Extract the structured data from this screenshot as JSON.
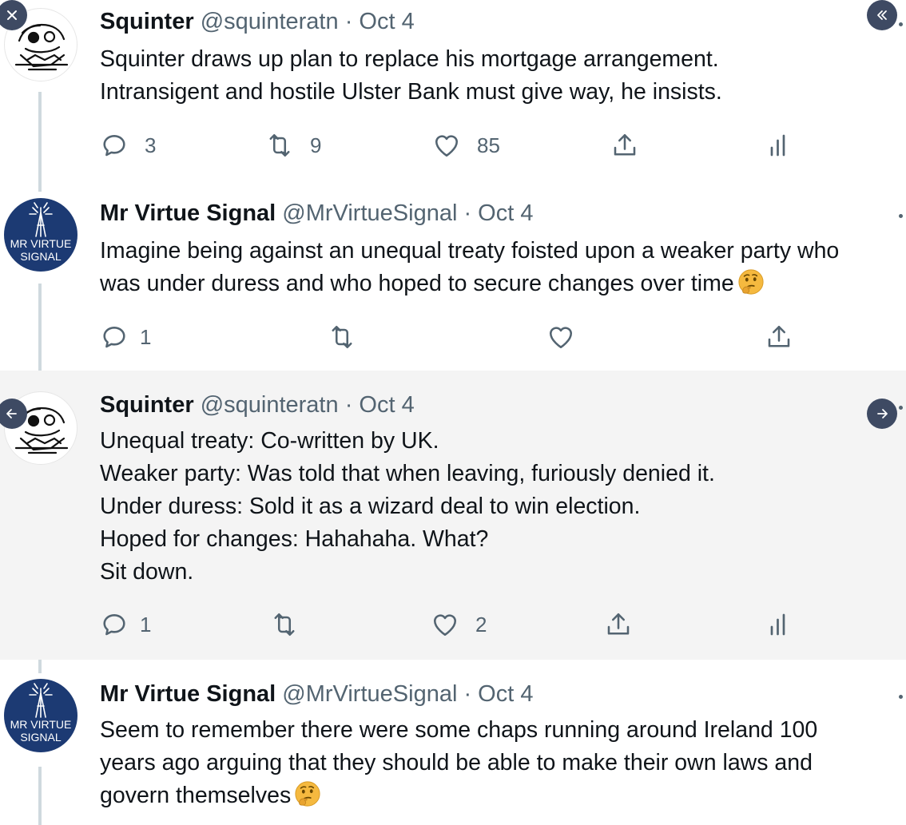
{
  "tweets": [
    {
      "name": "Squinter",
      "handle": "@squinteratn",
      "time": "· Oct 4",
      "lines": [
        "Squinter draws up plan to replace his mortgage arrangement.",
        "Intransigent and hostile Ulster Bank must give way, he insists."
      ],
      "replies": "3",
      "retweets": "9",
      "likes": "85"
    },
    {
      "name": "Mr Virtue Signal",
      "handle": "@MrVirtueSignal",
      "time": "· Oct 4",
      "avatar_text_1": "MR VIRTUE",
      "avatar_text_2": "SIGNAL",
      "lines": [
        "Imagine being against an unequal treaty foisted upon a weaker party who",
        "was under duress and who hoped to secure changes over time"
      ],
      "emoji": "thinking-face",
      "replies": "1",
      "retweets": "",
      "likes": ""
    },
    {
      "name": "Squinter",
      "handle": "@squinteratn",
      "time": "· Oct 4",
      "lines": [
        "Unequal treaty: Co-written by UK.",
        "Weaker party: Was told that when leaving, furiously denied it.",
        "Under duress: Sold it as a wizard deal to win election.",
        "Hoped for changes: Hahahaha. What?",
        "Sit down."
      ],
      "replies": "1",
      "retweets": "",
      "likes": "2"
    },
    {
      "name": "Mr Virtue Signal",
      "handle": "@MrVirtueSignal",
      "time": "· Oct 4",
      "avatar_text_1": "MR VIRTUE",
      "avatar_text_2": "SIGNAL",
      "lines": [
        "Seem to remember there were some chaps running around Ireland 100",
        "years ago arguing that they should be able to make their own laws and",
        "govern themselves"
      ],
      "emoji": "thinking-face"
    }
  ],
  "icons": {
    "reply": "reply-icon",
    "retweet": "retweet-icon",
    "like": "heart-icon",
    "share": "share-icon",
    "analytics": "analytics-icon",
    "close": "close-icon",
    "collapse": "double-chevron-left-icon",
    "prev": "arrow-left-icon",
    "next": "arrow-right-icon"
  },
  "colors": {
    "text": "#0f1419",
    "muted": "#536471",
    "highlight_bg": "#f4f4f4",
    "nav_button": "#3e4a63",
    "avatar_blue": "#1c3a73"
  }
}
